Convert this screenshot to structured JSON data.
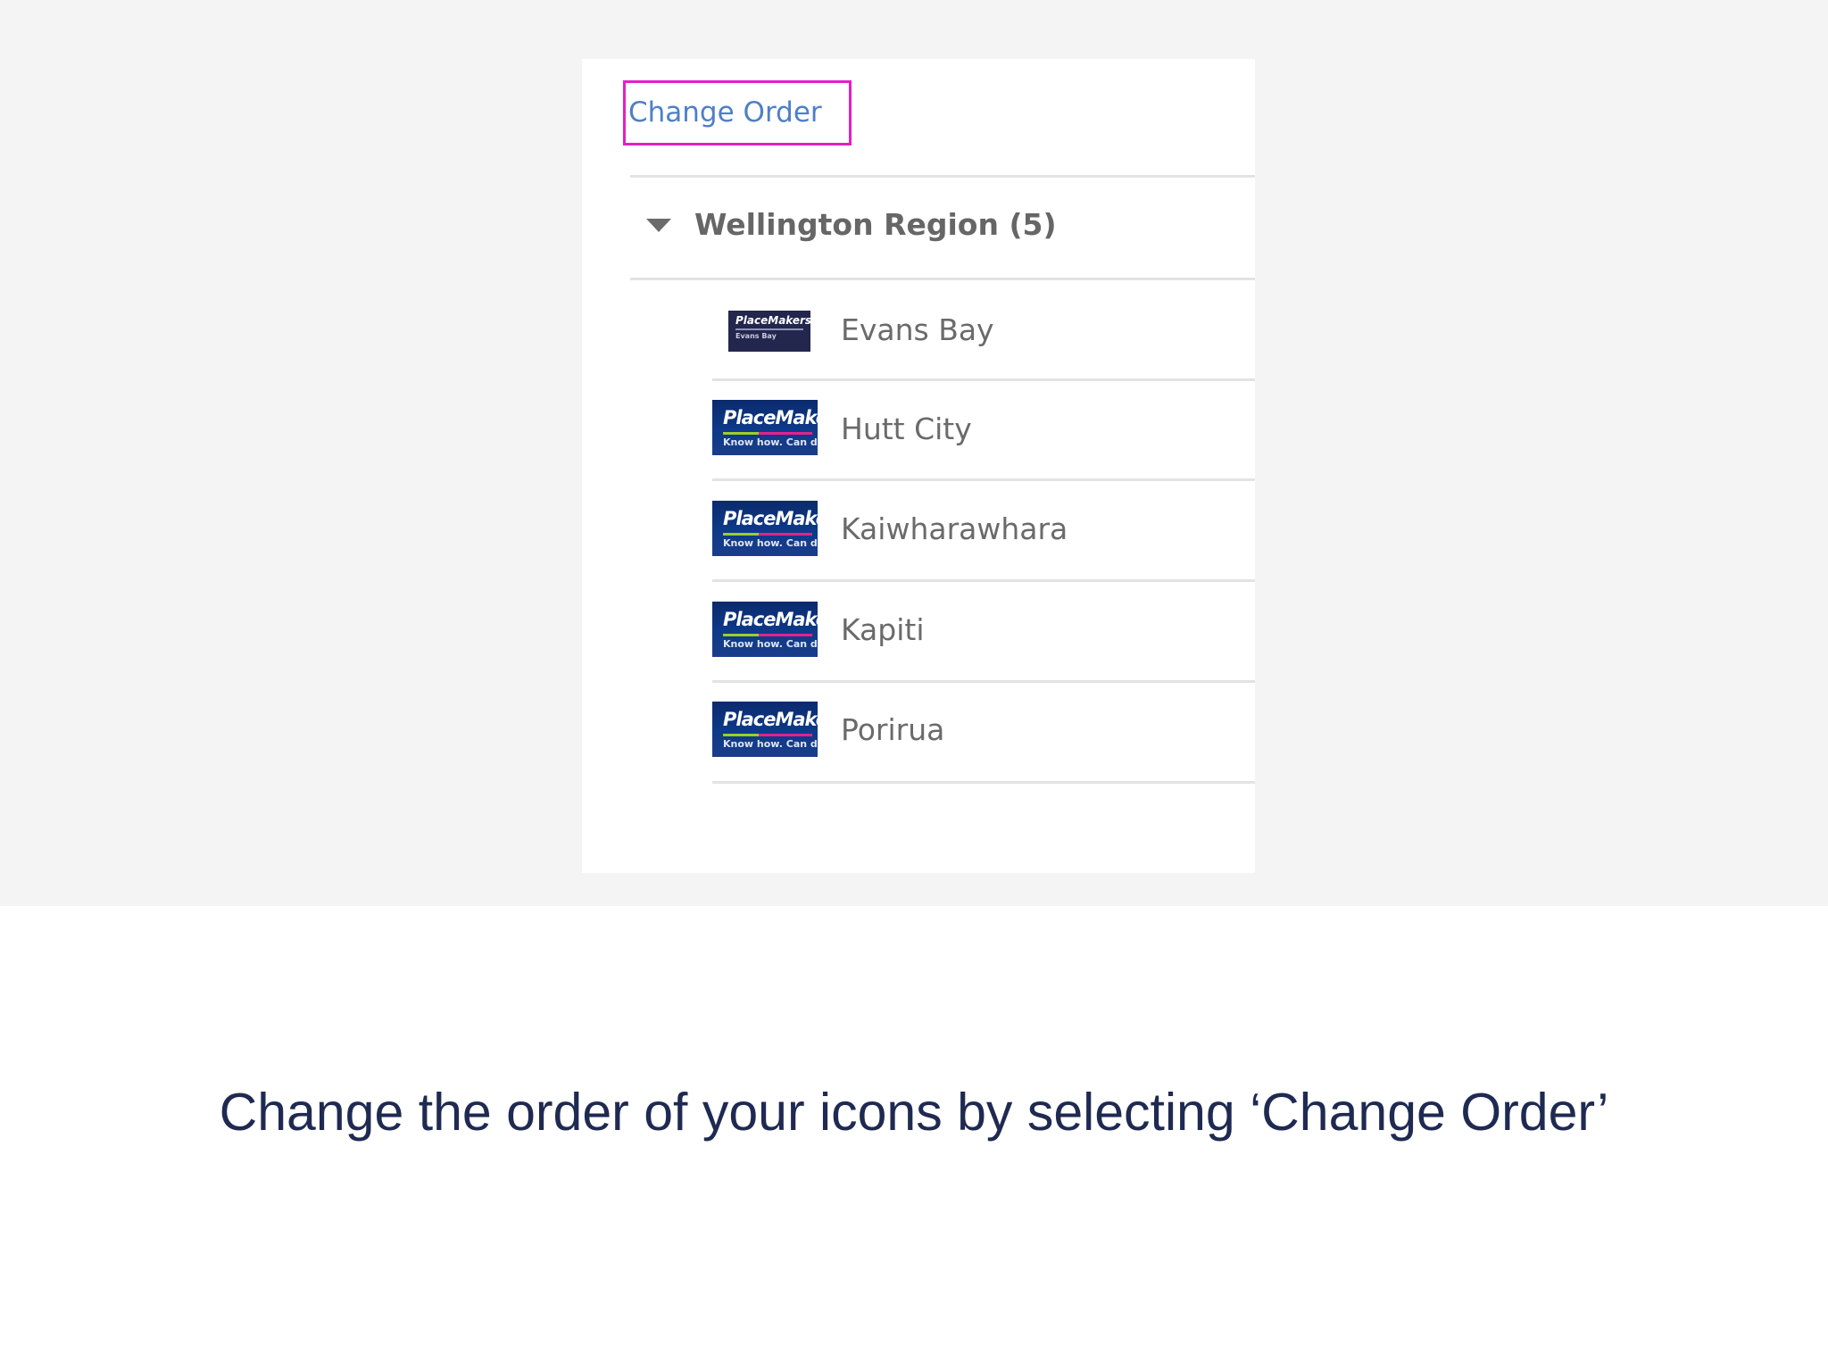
{
  "panel": {
    "change_order_label": "Change Order",
    "region": {
      "label": "Wellington Region (5)",
      "expanded": true
    },
    "stores": [
      {
        "name": "Evans Bay",
        "logo_text": "PlaceMakers",
        "logo_sub": "Evans Bay"
      },
      {
        "name": "Hutt City",
        "logo_text": "PlaceMakers",
        "logo_sub": "Know how. Can do."
      },
      {
        "name": "Kaiwharawhara",
        "logo_text": "PlaceMakers",
        "logo_sub": "Know how. Can do."
      },
      {
        "name": "Kapiti",
        "logo_text": "PlaceMakers",
        "logo_sub": "Know how. Can do."
      },
      {
        "name": "Porirua",
        "logo_text": "PlaceMakers",
        "logo_sub": "Know how. Can do."
      }
    ]
  },
  "caption": "Change the order of your icons by selecting ‘Change Order’",
  "colors": {
    "highlight_border": "#e31fc6",
    "link": "#4e7fc8",
    "caption_text": "#1f2a52",
    "background": "#f5f4f5"
  }
}
